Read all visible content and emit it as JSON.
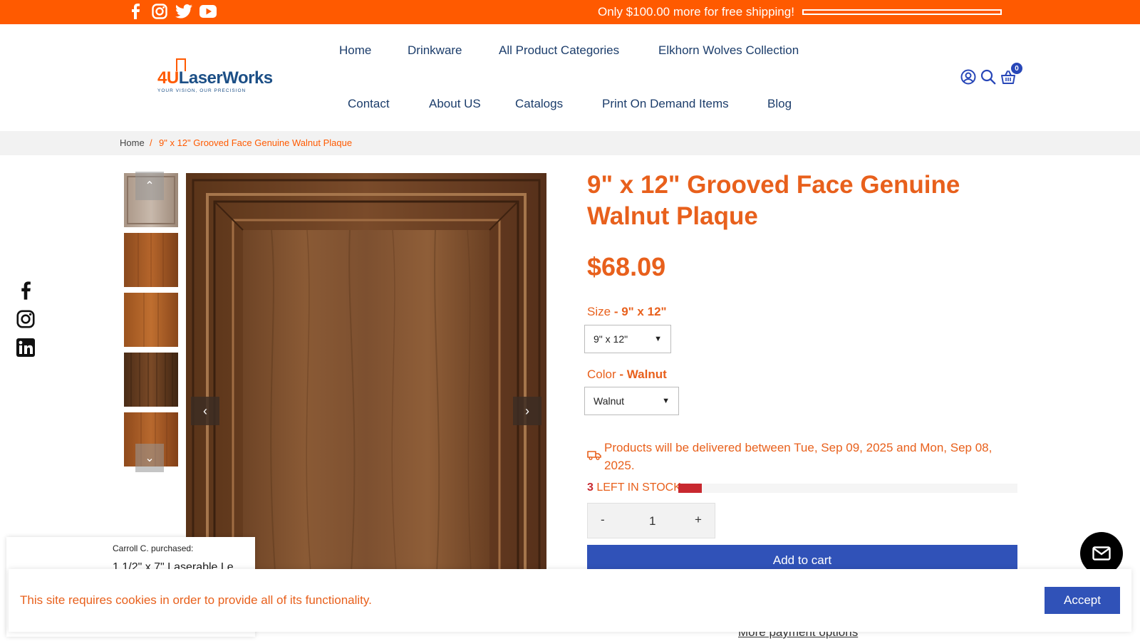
{
  "topbar": {
    "shipping_text": "Only $100.00 more for free shipping!",
    "shipping_progress_pct": 0,
    "social_icons": [
      "facebook-icon",
      "instagram-icon",
      "twitter-icon",
      "youtube-icon"
    ]
  },
  "header": {
    "logo": {
      "brand_prefix": "4U",
      "brand_name": "LaserWorks",
      "tagline": "YOUR VISION, OUR PRECISION"
    },
    "nav_row1": [
      "Home",
      "Drinkware",
      "All Product Categories",
      "Elkhorn Wolves Collection"
    ],
    "nav_row2": [
      "Contact",
      "About US",
      "Catalogs",
      "Print On Demand Items",
      "Blog"
    ],
    "cart_count": "0",
    "icons": [
      "account-icon",
      "search-icon",
      "cart-icon"
    ]
  },
  "breadcrumb": {
    "home": "Home",
    "separator": "/",
    "current": "9\" x 12\" Grooved Face Genuine Walnut Plaque"
  },
  "side_social": [
    "facebook-icon",
    "instagram-icon",
    "linkedin-icon"
  ],
  "product": {
    "title": "9\" x 12\" Grooved Face Genuine Walnut Plaque",
    "price": "$68.09",
    "size_label": "Size",
    "size_value": "- 9\" x 12\"",
    "size_selected": "9\" x 12\"",
    "color_label": "Color",
    "color_value": "- Walnut",
    "color_selected": "Walnut",
    "delivery_text": "Products will be delivered between Tue, Sep 09, 2025 and Mon, Sep 08, 2025.",
    "stock_count": "3",
    "stock_text": "LEFT IN STOCK",
    "stock_level_fraction": 0.07,
    "qty_minus": "-",
    "qty_value": "1",
    "qty_plus": "+",
    "add_to_cart": "Add to cart",
    "more_payment": "More payment options"
  },
  "gallery": {
    "up_arrow": "⌃",
    "down_arrow": "⌄",
    "prev": "‹",
    "next": "›"
  },
  "popup": {
    "who": "Carroll C. purchased:",
    "product": "1 1/2\" x 7\" Laserable Le"
  },
  "cookie": {
    "message": "This site requires cookies in order to provide all of its functionality.",
    "accept": "Accept"
  },
  "colors": {
    "brand_orange": "#ff5a00",
    "text_orange": "#e8601c",
    "nav_blue": "#1c3d6b",
    "button_blue": "#3052b8",
    "stock_red": "#c8282f"
  }
}
